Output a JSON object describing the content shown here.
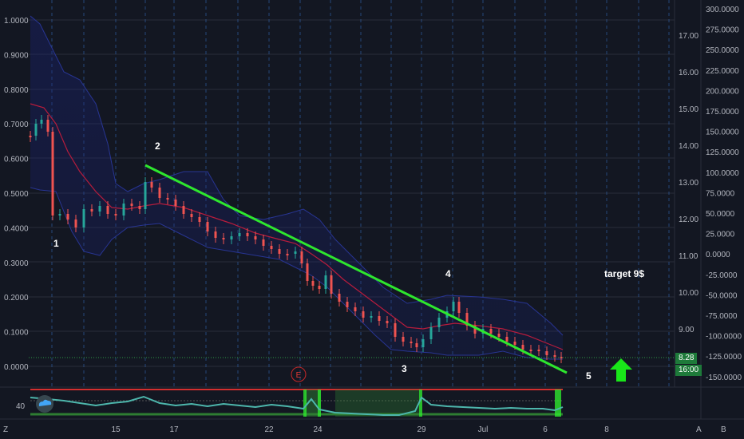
{
  "axes": {
    "left_ticks": [
      "1.0000",
      "0.9000",
      "0.8000",
      "0.7000",
      "0.6000",
      "0.5000",
      "0.4000",
      "0.3000",
      "0.2000",
      "0.1000",
      "0.0000"
    ],
    "mid_ticks": [
      "17.00",
      "16.00",
      "15.00",
      "14.00",
      "13.00",
      "12.00",
      "11.00",
      "10.00",
      "9.00"
    ],
    "right_ticks": [
      "300.0000",
      "275.0000",
      "250.0000",
      "225.0000",
      "200.0000",
      "175.0000",
      "150.0000",
      "125.0000",
      "100.0000",
      "75.0000",
      "50.0000",
      "25.0000",
      "0.0000",
      "-25.0000",
      "-50.0000",
      "-75.0000",
      "-100.0000",
      "-125.0000",
      "-150.0000"
    ],
    "x_ticks": [
      "15",
      "17",
      "22",
      "24",
      "29",
      "Jul",
      "6",
      "8"
    ],
    "osc_tick": "40",
    "corner_left": "Z",
    "corner_right_a": "A",
    "corner_right_b": "B"
  },
  "annotations": {
    "wave1": "1",
    "wave2": "2",
    "wave3": "3",
    "wave4": "4",
    "wave5": "5",
    "target": "target 9$",
    "earnings": "E"
  },
  "last_price": "8.28",
  "timeframe": "16:00",
  "colors": {
    "background": "#131722",
    "trendline": "#2ee62e",
    "arrow": "#19e619",
    "band": "#1a237e",
    "ma": "#b71c3c"
  }
}
